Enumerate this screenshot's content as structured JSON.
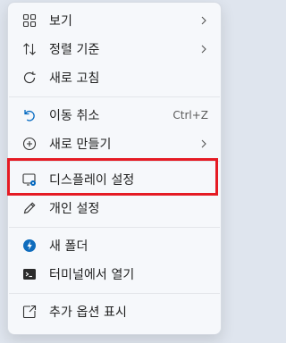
{
  "menu": {
    "items": [
      {
        "label": "보기",
        "icon": "grid-icon",
        "has_submenu": true
      },
      {
        "label": "정렬 기준",
        "icon": "sort-icon",
        "has_submenu": true
      },
      {
        "label": "새로 고침",
        "icon": "refresh-icon",
        "has_submenu": false
      },
      {
        "label": "이동 취소",
        "icon": "undo-icon",
        "shortcut": "Ctrl+Z",
        "has_submenu": false
      },
      {
        "label": "새로 만들기",
        "icon": "plus-circle-icon",
        "has_submenu": true
      },
      {
        "label": "디스플레이 설정",
        "icon": "display-settings-icon",
        "has_submenu": false
      },
      {
        "label": "개인 설정",
        "icon": "pencil-icon",
        "has_submenu": false
      },
      {
        "label": "새 폴더",
        "icon": "new-folder-icon",
        "has_submenu": false
      },
      {
        "label": "터미널에서 열기",
        "icon": "terminal-icon",
        "has_submenu": false
      },
      {
        "label": "추가 옵션 표시",
        "icon": "more-options-icon",
        "has_submenu": false
      }
    ]
  },
  "colors": {
    "highlight": "#e51b24",
    "accent": "#0067c0"
  }
}
